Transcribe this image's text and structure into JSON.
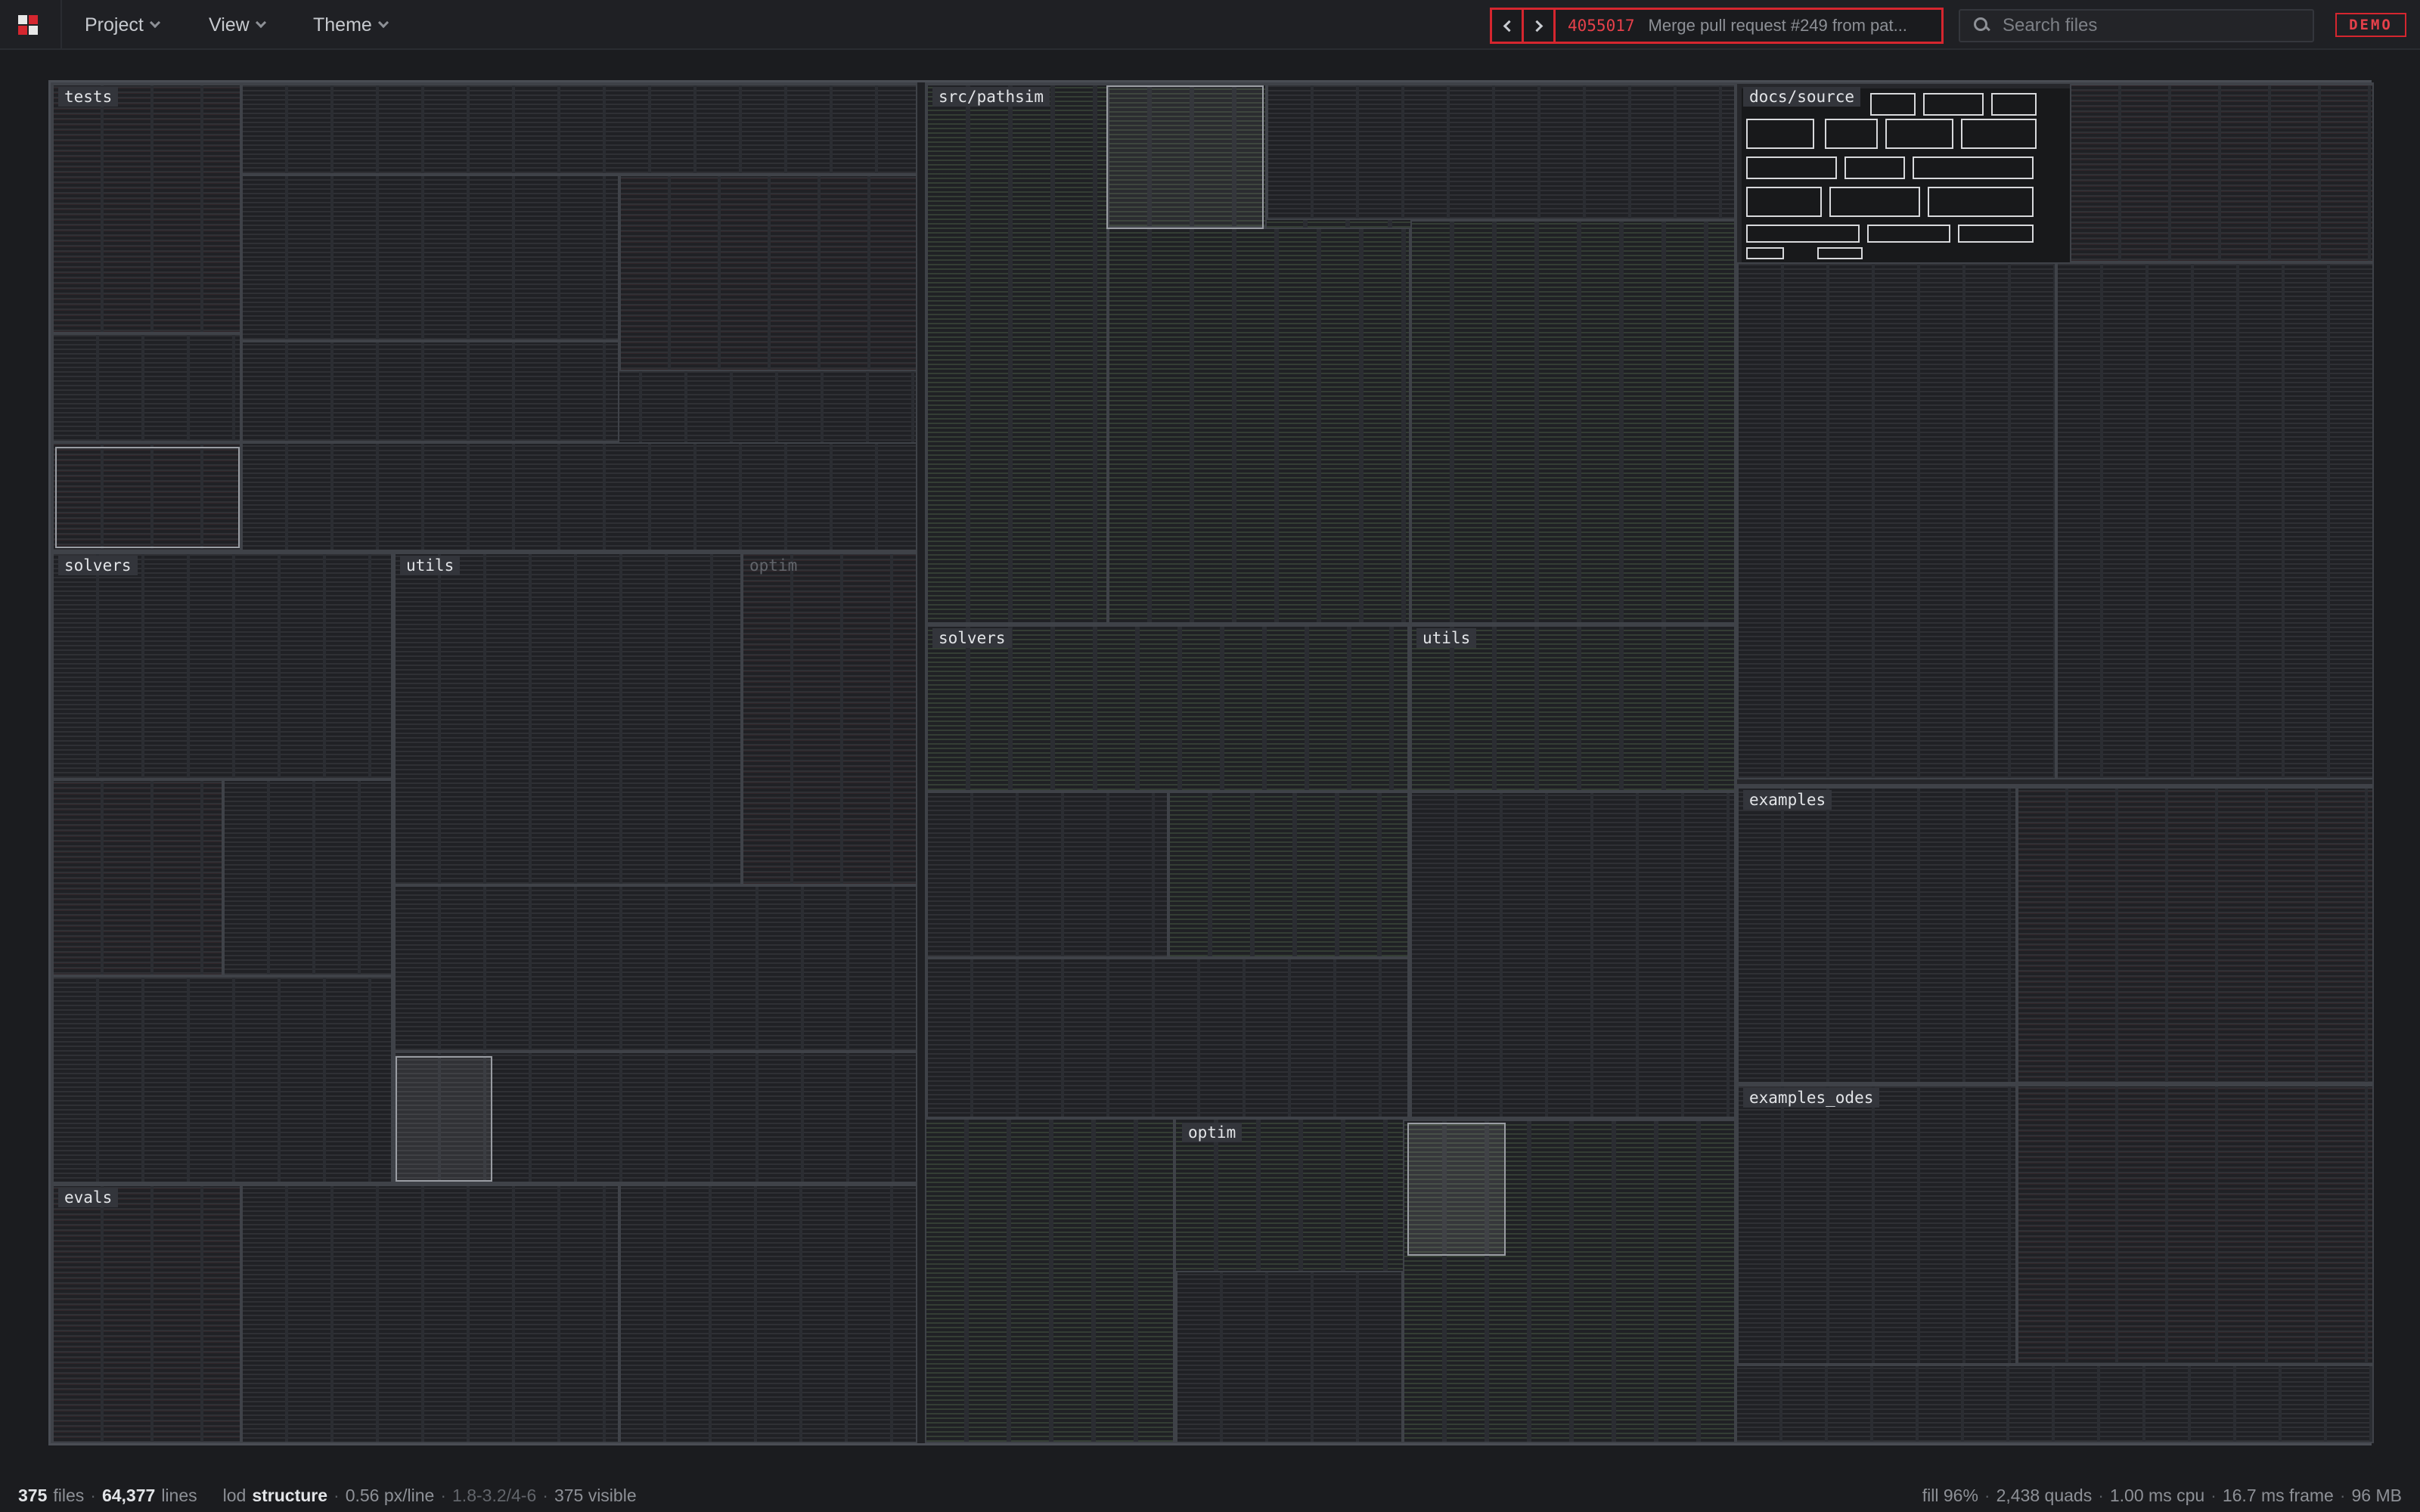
{
  "menu": {
    "project": "Project",
    "view": "View",
    "theme": "Theme"
  },
  "commit": {
    "hash": "4055017",
    "message": "Merge pull request #249 from pat..."
  },
  "search": {
    "placeholder": "Search files"
  },
  "badge": "DEMO",
  "treemap": {
    "folders": {
      "tests": "tests",
      "solvers_left": "solvers",
      "utils_left": "utils",
      "optim_left": "optim",
      "evals": "evals",
      "src_pathsim": "src/pathsim",
      "solvers_mid": "solvers",
      "utils_mid": "utils",
      "optim_mid": "optim",
      "docs_source": "docs/source",
      "examples": "examples",
      "examples_odes": "examples_odes"
    }
  },
  "status": {
    "files_count": "375",
    "files_label": "files",
    "lines_count": "64,377",
    "lines_label": "lines",
    "lod_label": "lod",
    "lod_value": "structure",
    "px_per_line": "0.56 px/line",
    "lod_range": "1.8-3.2/4-6",
    "visible": "375 visible",
    "fill": "fill 96%",
    "quads": "2,438 quads",
    "cpu": "1.00 ms cpu",
    "frame": "16.7 ms frame",
    "memory": "96 MB"
  }
}
